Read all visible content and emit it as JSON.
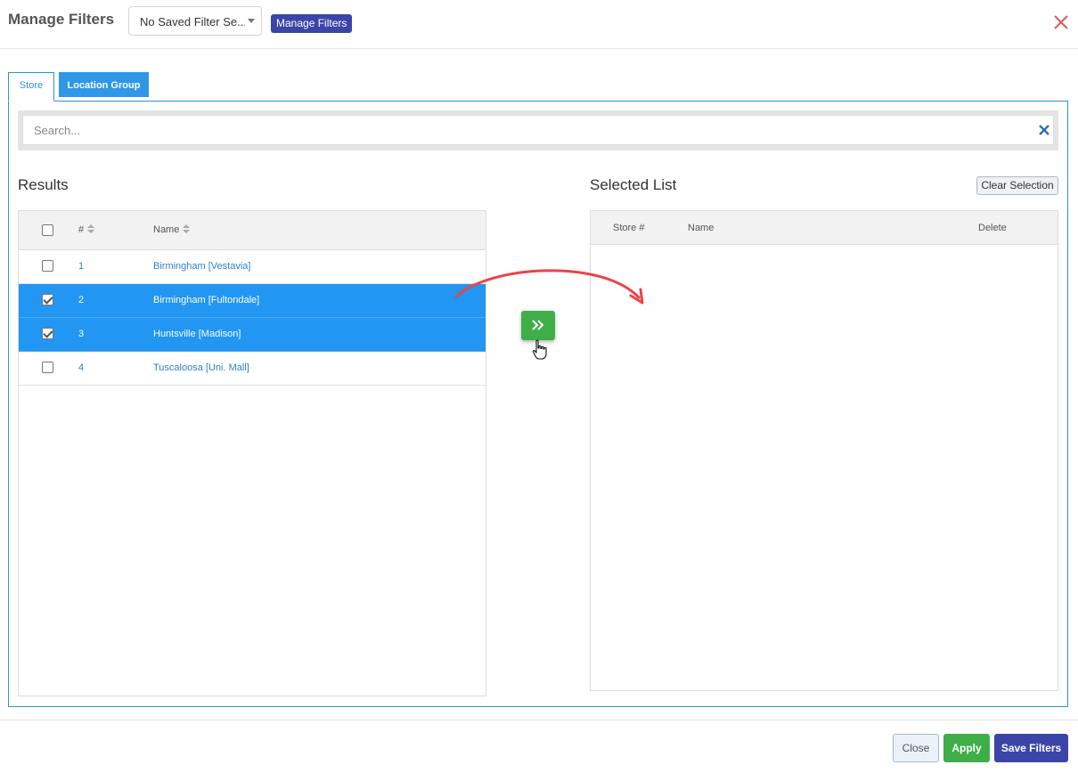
{
  "header": {
    "title": "Manage Filters",
    "saved_filter_value": "No Saved Filter Se...",
    "manage_button": "Manage Filters"
  },
  "tabs": [
    {
      "label": "Store",
      "active": true
    },
    {
      "label": "Location Group",
      "active": false
    }
  ],
  "search": {
    "placeholder": "Search..."
  },
  "results": {
    "heading": "Results",
    "columns": [
      "#",
      "Name"
    ],
    "rows": [
      {
        "num": "1",
        "name": "Birmingham [Vestavia]",
        "checked": false
      },
      {
        "num": "2",
        "name": "Birmingham [Fultondale]",
        "checked": true
      },
      {
        "num": "3",
        "name": "Huntsville [Madison]",
        "checked": true
      },
      {
        "num": "4",
        "name": "Tuscaloosa [Uni. Mall]",
        "checked": false
      }
    ]
  },
  "selected": {
    "heading": "Selected List",
    "clear_button": "Clear Selection",
    "columns": [
      "Store #",
      "Name",
      "Delete"
    ]
  },
  "footer": {
    "close": "Close",
    "apply": "Apply",
    "save": "Save Filters"
  },
  "colors": {
    "accent_blue": "#2196f3",
    "green": "#3fae49",
    "indigo": "#3b45a8",
    "close_red": "#e05a5a",
    "arrow_red": "#e8454a"
  }
}
